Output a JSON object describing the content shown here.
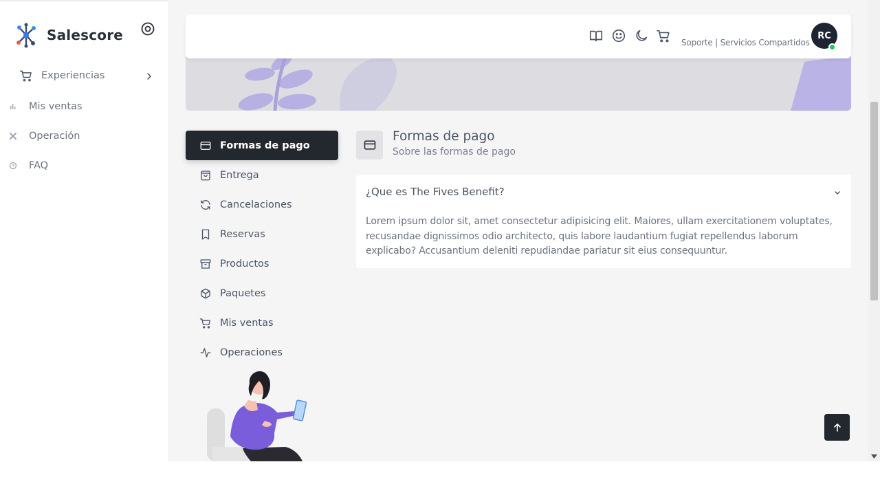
{
  "brand": {
    "name": "Salescore"
  },
  "sidebar": {
    "experiences_label": "Experiencias",
    "items": [
      {
        "label": "Mis ventas",
        "icon": "bar-chart-icon"
      },
      {
        "label": "Operación",
        "icon": "tools-icon"
      },
      {
        "label": "FAQ",
        "icon": "clock-icon"
      }
    ]
  },
  "topbar": {
    "support_text": "Soporte | Servicios Compartidos",
    "avatar_initials": "RC",
    "icons": [
      "book-icon",
      "smile-icon",
      "moon-icon",
      "cart-icon"
    ]
  },
  "categories": [
    {
      "label": "Formas de pago",
      "icon": "credit-card-icon",
      "active": true
    },
    {
      "label": "Entrega",
      "icon": "bag-icon"
    },
    {
      "label": "Cancelaciones",
      "icon": "refresh-icon"
    },
    {
      "label": "Reservas",
      "icon": "bookmark-icon"
    },
    {
      "label": "Productos",
      "icon": "archive-icon"
    },
    {
      "label": "Paquetes",
      "icon": "package-icon"
    },
    {
      "label": "Mis ventas",
      "icon": "cart-icon"
    },
    {
      "label": "Operaciones",
      "icon": "activity-icon"
    }
  ],
  "section": {
    "title": "Formas de pago",
    "subtitle": "Sobre las formas de pago"
  },
  "faq": {
    "question": "¿Que es The Fives Benefit?",
    "answer": "Lorem ipsum dolor sit, amet consectetur adipisicing elit. Maiores, ullam exercitationem voluptates, recusandae dignissimos odio architecto, quis labore laudantium fugiat repellendus laborum explicabo? Accusantium deleniti repudiandae pariatur sit eius consequuntur."
  },
  "colors": {
    "accent_dark": "#23272e",
    "status_online": "#22c55e",
    "illustration_purple": "#7c6fdc"
  }
}
